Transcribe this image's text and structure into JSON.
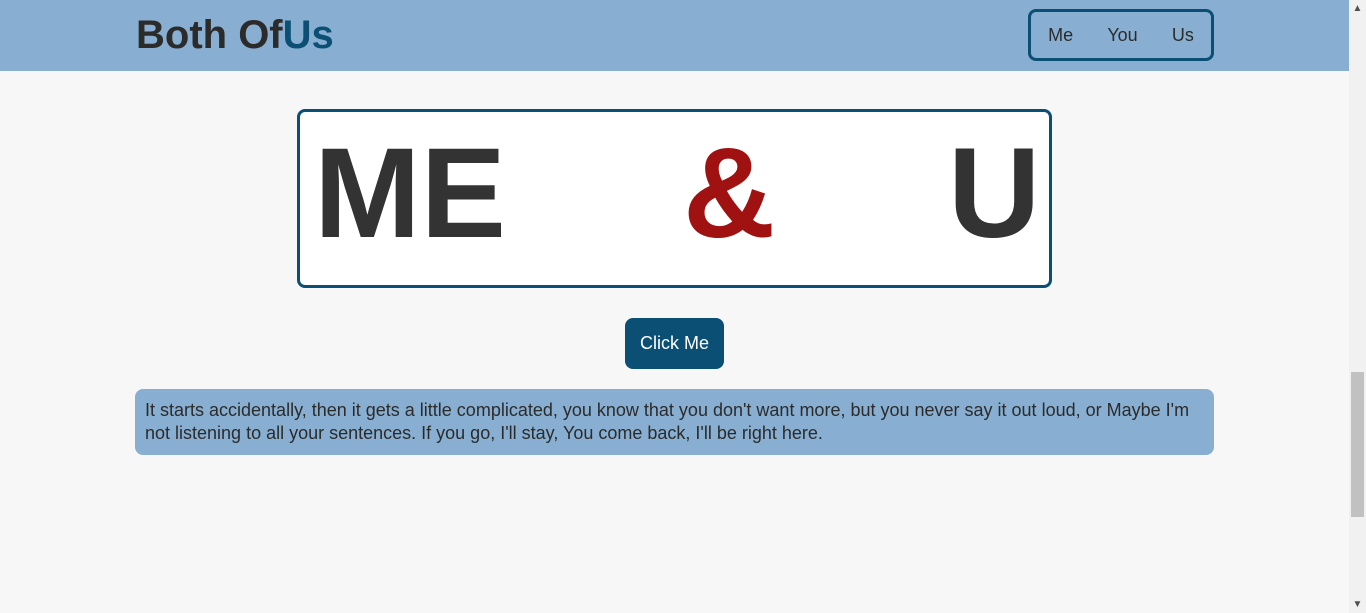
{
  "header": {
    "logo_main": "Both Of",
    "logo_accent": "Us",
    "nav": [
      "Me",
      "You",
      "Us"
    ]
  },
  "banner": {
    "left": "ME",
    "middle": "&",
    "right": "U"
  },
  "button": {
    "label": "Click Me"
  },
  "paragraph": "It starts accidentally, then it gets a little complicated, you know that you don't want more, but you never say it out loud, or Maybe I'm not listening to all your sentences. If you go, I'll stay, You come back, I'll be right here.",
  "colors": {
    "header_bg": "#88afd2",
    "accent": "#0b4f75",
    "ampersand": "#a01212",
    "text": "#2b2b2b"
  },
  "icons": {
    "scroll_up": "chevron-up-icon",
    "scroll_down": "chevron-down-icon"
  }
}
